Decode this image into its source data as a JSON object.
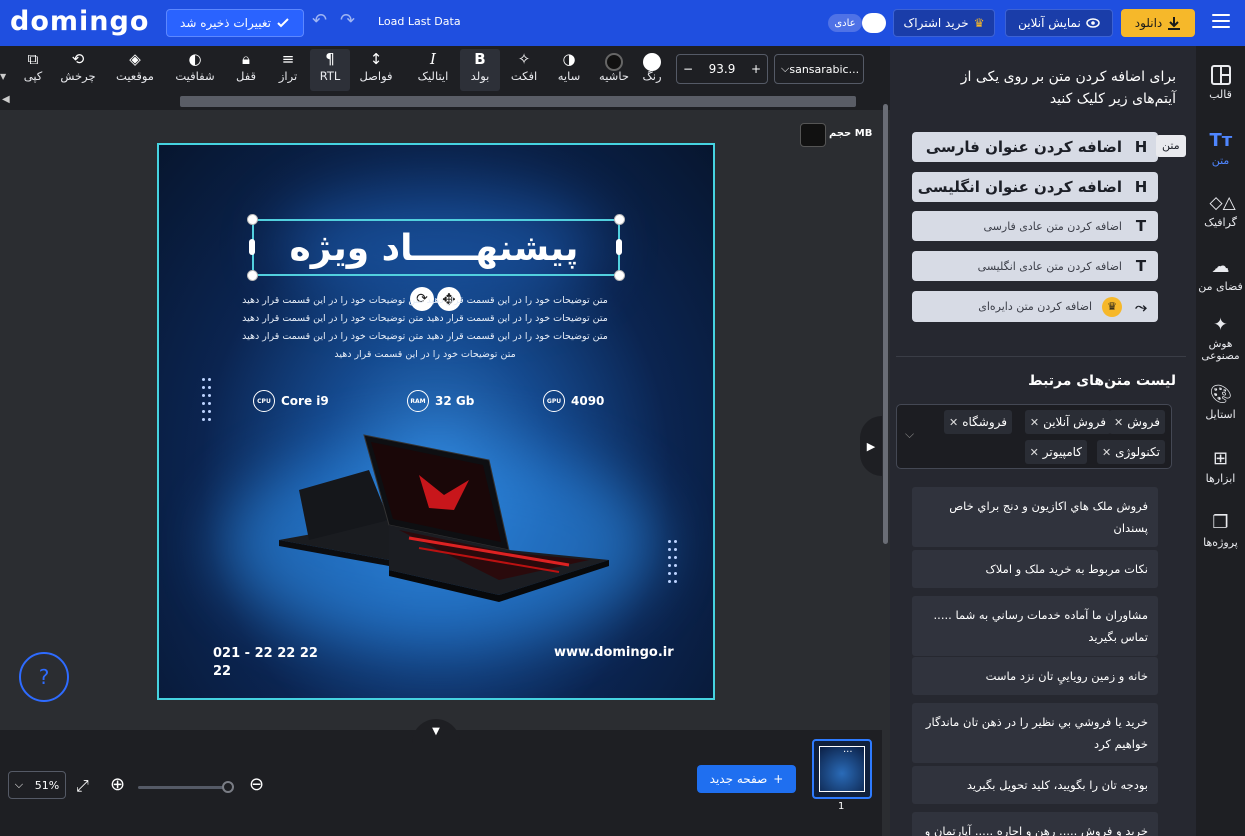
{
  "topbar": {
    "logo": "domingo",
    "saved_label": "تغییرات ذخیره شد",
    "load_last": "Load Last Data",
    "mode_badge": "عادی",
    "subscription": "خرید اشتراک",
    "show_online": "نمایش آنلاین",
    "download": "دانلود"
  },
  "toolbar": {
    "tools": [
      {
        "label": "کپی",
        "icon": "copy-icon"
      },
      {
        "label": "چرخش",
        "icon": "rotate-icon"
      },
      {
        "label": "موقعیت",
        "icon": "layers-icon"
      },
      {
        "label": "شفافیت",
        "icon": "opacity-icon"
      },
      {
        "label": "قفل",
        "icon": "lock-icon"
      },
      {
        "label": "تراز",
        "icon": "align-icon"
      },
      {
        "label": "RTL",
        "icon": "rtl-icon"
      },
      {
        "label": "فواصل",
        "icon": "spacing-icon"
      },
      {
        "label": "ایتالیک",
        "icon": "italic-icon"
      },
      {
        "label": "بولد",
        "icon": "bold-icon"
      },
      {
        "label": "افکت",
        "icon": "effect-icon"
      },
      {
        "label": "سایه",
        "icon": "shadow-icon"
      },
      {
        "label": "حاشیه",
        "icon": "border-icon"
      },
      {
        "label": "رنگ",
        "icon": "color-icon"
      }
    ],
    "font_size": "93.9",
    "font_name": "sansarabic...",
    "italic_glyph": "I",
    "bold_glyph": "B"
  },
  "canvas": {
    "size_label": "حجم MB",
    "title": "پیشنهـــــاد ویژه",
    "description": [
      "متن توضیحات خود را در این قسمت قرار دهید متن توضیحات خود را در این قسمت قرار دهید",
      "متن توضیحات خود را در این قسمت قرار دهید متن توضیحات خود را در این قسمت قرار دهید",
      "متن توضیحات خود را در این قسمت قرار دهید متن توضیحات خود را در این قسمت قرار دهید",
      "متن توضیحات خود را در این قسمت قرار دهید"
    ],
    "specs": [
      {
        "chip": "CPU",
        "value": "Core i9"
      },
      {
        "chip": "RAM",
        "value": "32 Gb"
      },
      {
        "chip": "GPU",
        "value": "4090"
      }
    ],
    "phone": "021 - 22 22 22 22",
    "website": "www.domingo.ir"
  },
  "panel": {
    "title": "برای اضافه کردن متن بر روی یکی از آیتم‌های زیر کلیک کنید",
    "tooltip": "متن",
    "add_items": [
      {
        "label": "اضافه کردن عنوان فارسی",
        "glyph": "H"
      },
      {
        "label": "اضافه کردن عنوان انگلیسی",
        "glyph": "H"
      },
      {
        "label": "اضافه کردن متن عادی فارسی",
        "glyph": "T"
      },
      {
        "label": "اضافه کردن متن عادی انگلیسی",
        "glyph": "T"
      },
      {
        "label": "اضافه کردن متن دایره‌ای",
        "glyph": "⤳"
      }
    ],
    "related_title": "لیست متن‌های مرتبط",
    "tags": [
      "فروش",
      "فروش آنلاین",
      "فروشگاه",
      "تکنولوژی",
      "کامپیوتر"
    ],
    "suggestions": [
      "فروش ملک هاي اكازيون و دنج براي خاص پسندان",
      "نكات مربوط به خريد ملک و املاک",
      "مشاوران ما آماده خدمات رساني به شما ..... تماس بگيريد",
      "خانه و زمين روياييِ تان نزد ماست",
      "خريد يا فروشي بي نظير را در ذهن تان ماندگار خواهيم كرد",
      "بودجه تان را بگوييد، كليد تحويل بگيريد",
      "خريد و فروش ..... رهن و اجاره ..... آپارتمان و"
    ]
  },
  "rightnav": [
    {
      "label": "قالب",
      "icon": "template-icon"
    },
    {
      "label": "متن",
      "icon": "text-icon"
    },
    {
      "label": "گرافیک",
      "icon": "graphics-icon"
    },
    {
      "label": "فضای من",
      "icon": "cloud-upload-icon"
    },
    {
      "label": "هوش مصنوعی",
      "icon": "magic-wand-icon"
    },
    {
      "label": "استایل",
      "icon": "palette-icon"
    },
    {
      "label": "ابزارها",
      "icon": "tools-icon"
    },
    {
      "label": "پروژه‌ها",
      "icon": "projects-icon"
    }
  ],
  "bottom": {
    "zoom": "51%",
    "new_page": "صفحه جدید",
    "page_number": "1",
    "thumb_menu": "..."
  },
  "colors": {
    "accent": "#1f4fe0",
    "download": "#f6b82a",
    "selection": "#46d3e0"
  }
}
